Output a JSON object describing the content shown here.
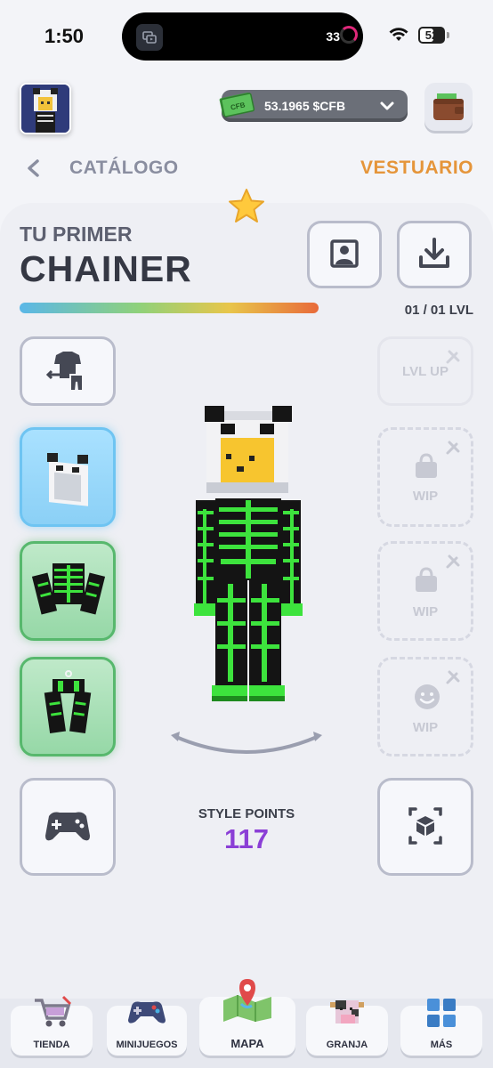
{
  "status": {
    "time": "1:50",
    "island_count": "33",
    "battery": "52"
  },
  "header": {
    "currency": "53.1965 $CFB",
    "cash_label": "CFB"
  },
  "breadcrumb": {
    "back_label": "CATÁLOGO",
    "section": "VESTUARIO"
  },
  "character": {
    "subtitle": "TU PRIMER",
    "title": "CHAINER",
    "level": "01 / 01 LVL",
    "level_progress": 1.0
  },
  "right_slots": {
    "lvl_up": "LVL UP",
    "wip_1": "WIP",
    "wip_2": "WIP",
    "wip_3": "WIP"
  },
  "style": {
    "label": "STYLE POINTS",
    "value": "117"
  },
  "nav": [
    {
      "label": "TIENDA",
      "icon": "cart-icon"
    },
    {
      "label": "MINIJUEGOS",
      "icon": "gamepad-icon"
    },
    {
      "label": "MAPA",
      "icon": "map-icon"
    },
    {
      "label": "GRANJA",
      "icon": "cow-icon"
    },
    {
      "label": "MÁS",
      "icon": "blocks-icon"
    }
  ],
  "colors": {
    "accent_orange": "#e5953a",
    "style_purple": "#8b3fd6",
    "skeleton_green": "#3de33d"
  }
}
